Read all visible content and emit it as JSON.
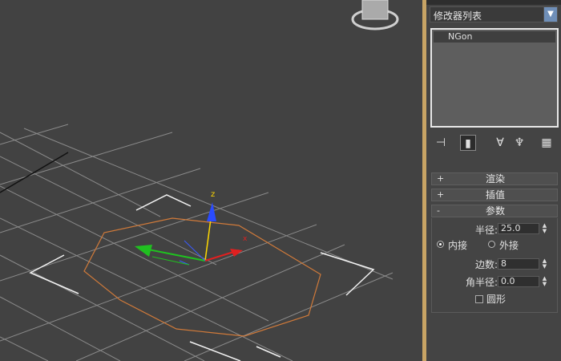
{
  "modifier_list": {
    "label": "修改器列表",
    "arrow_icon": "chevron-down-icon"
  },
  "modifier_stack": {
    "items": [
      "NGon"
    ]
  },
  "toolbar_icons": [
    "pin-stack-icon",
    "show-end-result-icon",
    "make-unique-icon",
    "remove-modifier-icon",
    "configure-modifier-sets-icon"
  ],
  "rollouts": {
    "render": {
      "sign": "+",
      "title": "渲染"
    },
    "interp": {
      "sign": "+",
      "title": "插值"
    },
    "params": {
      "sign": "-",
      "title": "参数"
    }
  },
  "params": {
    "radius_label": "半径:",
    "radius_value": "25.0",
    "inscribed_label": "内接",
    "circumscribed_label": "外接",
    "inscribed_selected": true,
    "sides_label": "边数:",
    "sides_value": "8",
    "corner_radius_label": "角半径:",
    "corner_radius_value": "0.0",
    "circular_label": "圆形",
    "circular_checked": false
  },
  "gizmo": {
    "z_label": "z",
    "x_label": "x"
  },
  "colors": {
    "accent": "#c8a465",
    "selection": "#d07a3a",
    "axis_z": "#2a4bff",
    "axis_x": "#e02020",
    "axis_y": "#20c020"
  }
}
